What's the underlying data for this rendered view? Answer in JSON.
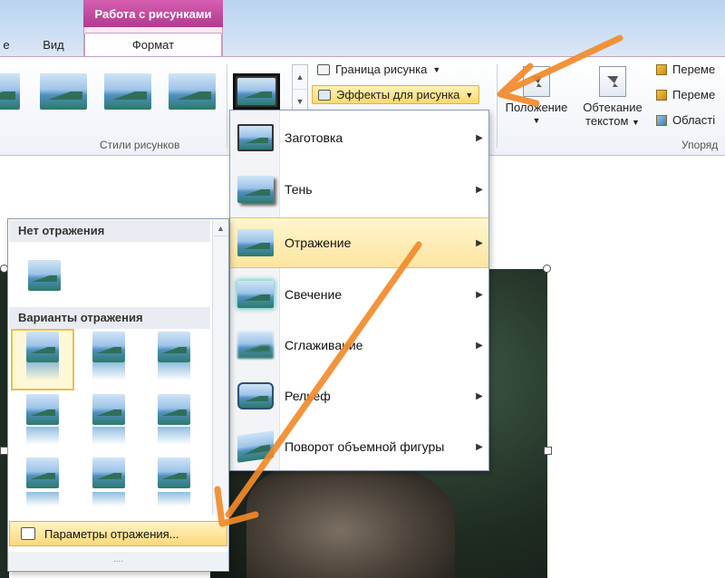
{
  "tabs": {
    "left_partial": "е",
    "view": "Вид",
    "context_group": "Работа с рисунками",
    "format": "Формат"
  },
  "ribbon": {
    "picture_styles_label": "Стили рисунков",
    "picture_border_label": "Граница рисунка",
    "picture_effects_label": "Эффекты для рисунка",
    "position_label": "Положение",
    "wrap_text_line1": "Обтекание",
    "wrap_text_line2": "текстом",
    "bring_forward_label": "Переме",
    "send_backward_label": "Переме",
    "selection_pane_label": "Області",
    "arrange_group_label": "Упоряд"
  },
  "effects_menu": {
    "items": [
      {
        "label": "Заготовка"
      },
      {
        "label": "Тень"
      },
      {
        "label": "Отражение"
      },
      {
        "label": "Свечение"
      },
      {
        "label": "Сглаживание"
      },
      {
        "label": "Рельеф"
      },
      {
        "label": "Поворот объемной фигуры"
      }
    ],
    "highlighted_index": 2
  },
  "reflection_gallery": {
    "no_reflection_header": "Нет отражения",
    "variants_header": "Варианты отражения",
    "options_button": "Параметры отражения...",
    "grip": "....",
    "selected_variant": 1
  },
  "colors": {
    "context_tab": "#c0479e",
    "highlight": "#fbd96c",
    "annotation_arrow": "#f28a2a"
  }
}
